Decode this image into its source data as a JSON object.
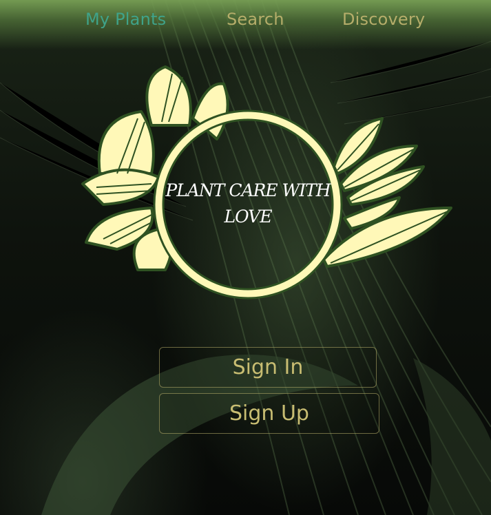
{
  "nav": {
    "items": [
      {
        "label": "My Plants",
        "active": true
      },
      {
        "label": "Search",
        "active": false
      },
      {
        "label": "Discovery",
        "active": false
      }
    ]
  },
  "logo": {
    "line1": "PLANT CARE WITH",
    "line2": "LOVE"
  },
  "auth": {
    "sign_in_label": "Sign In",
    "sign_up_label": "Sign Up"
  },
  "colors": {
    "nav_active": "#3fa38a",
    "nav_inactive": "#b5ad6a",
    "button_text": "#c8bd72",
    "logo_fill": "#fff8b8",
    "logo_outline": "#2f5222"
  }
}
